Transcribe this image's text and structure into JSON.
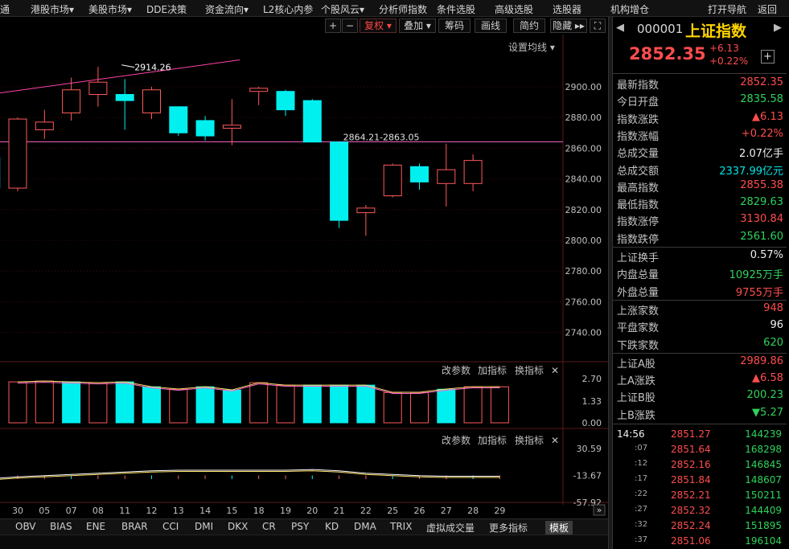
{
  "top_menu": [
    {
      "label": "通"
    },
    {
      "label": "港股市场▾"
    },
    {
      "label": "美股市场▾"
    },
    {
      "label": "DDE决策"
    },
    {
      "label": "资金流向▾"
    },
    {
      "label": "L2核心内参"
    },
    {
      "label": "个股风云▾"
    },
    {
      "label": "分析师指数"
    },
    {
      "label": "条件选股"
    },
    {
      "label": "高级选股"
    },
    {
      "label": "选股器"
    },
    {
      "label": "机构增仓"
    },
    {
      "label": "打开导航"
    },
    {
      "label": "返回"
    }
  ],
  "toolbar": {
    "plus": "+",
    "minus": "−",
    "fuquan": "复权 ▾",
    "overlay": "叠加 ▾",
    "chips": "筹码",
    "draw": "画线",
    "simple": "简约",
    "hide": "隐藏 ▸▸",
    "fullscreen": "⛶"
  },
  "ma_settings": "设置均线 ▾",
  "chart_data": [
    {
      "type": "candlestick",
      "x": [
        "29",
        "30",
        "05",
        "07",
        "08",
        "11",
        "12",
        "13",
        "14",
        "15",
        "18",
        "19",
        "20",
        "21",
        "22",
        "25",
        "26",
        "27",
        "28",
        "29"
      ],
      "x_tick_labels": [
        "30",
        "05",
        "07",
        "08",
        "11",
        "12",
        "13",
        "14",
        "15",
        "18",
        "19",
        "20",
        "21",
        "22",
        "25",
        "26",
        "27",
        "28",
        "29"
      ],
      "ohlc": [
        [
          2854,
          2868,
          2832,
          2834
        ],
        [
          2834,
          2880,
          2832,
          2879
        ],
        [
          2872,
          2885,
          2866,
          2877
        ],
        [
          2883,
          2906,
          2878,
          2898
        ],
        [
          2895,
          2913,
          2887,
          2903
        ],
        [
          2895,
          2905,
          2872,
          2891
        ],
        [
          2883,
          2900,
          2879,
          2898
        ],
        [
          2887,
          2887,
          2868,
          2870
        ],
        [
          2878,
          2881,
          2865,
          2868
        ],
        [
          2873,
          2892,
          2862,
          2875
        ],
        [
          2897,
          2900,
          2888,
          2899
        ],
        [
          2897,
          2898,
          2881,
          2885
        ],
        [
          2891,
          2892,
          2864,
          2864
        ],
        [
          2864,
          2864,
          2808,
          2813
        ],
        [
          2818,
          2823,
          2803,
          2821
        ],
        [
          2829,
          2850,
          2828,
          2849
        ],
        [
          2848,
          2850,
          2833,
          2838
        ],
        [
          2837,
          2863,
          2822,
          2846
        ],
        [
          2837,
          2856,
          2832,
          2852
        ]
      ],
      "y_ticks": [
        2900,
        2880,
        2860,
        2840,
        2820,
        2800,
        2780,
        2760,
        2740
      ],
      "y_tick_labels": [
        "2900.00",
        "2880.00",
        "2860.00",
        "2840.00",
        "2820.00",
        "2800.00",
        "2780.00",
        "2760.00",
        "2740.00"
      ],
      "ylim": [
        2722,
        2934
      ],
      "annotations": [
        {
          "text": "2914.26",
          "x": "11",
          "y": 2914.26
        },
        {
          "text": "2864.21-2863.05",
          "x": "21",
          "y": 2864.21
        }
      ],
      "hline": 2864.21
    },
    {
      "type": "bar",
      "name": "indicator-panel-1",
      "categories": [
        "30",
        "05",
        "07",
        "08",
        "11",
        "12",
        "13",
        "14",
        "15",
        "18",
        "19",
        "20",
        "21",
        "22",
        "25",
        "26",
        "27",
        "28",
        "29"
      ],
      "values": [
        2.5,
        2.55,
        2.5,
        2.45,
        2.5,
        2.2,
        2.05,
        2.2,
        2.0,
        2.45,
        2.3,
        2.3,
        2.3,
        2.3,
        1.85,
        1.85,
        2.05,
        2.2,
        2.2
      ],
      "colors_by_direction": [
        "up",
        "up",
        "down",
        "up",
        "down",
        "down",
        "up",
        "down",
        "down",
        "up",
        "up",
        "down",
        "down",
        "down",
        "up",
        "up",
        "down",
        "up",
        "up"
      ],
      "y_tick_labels": [
        "2.70",
        "1.33",
        "0.00"
      ],
      "ylim": [
        0,
        2.7
      ],
      "header_buttons": [
        "改参数",
        "加指标",
        "换指标",
        "✕"
      ]
    },
    {
      "type": "line",
      "name": "indicator-panel-2",
      "y_tick_labels": [
        "30.59",
        "-13.67",
        "-57.92"
      ],
      "ylim": [
        -57.92,
        30.59
      ],
      "header_buttons": [
        "改参数",
        "加指标",
        "换指标",
        "✕"
      ]
    }
  ],
  "bottom_tabs": [
    {
      "label": "OBV"
    },
    {
      "label": "BIAS"
    },
    {
      "label": "ENE"
    },
    {
      "label": "BRAR"
    },
    {
      "label": "CCI"
    },
    {
      "label": "DMI"
    },
    {
      "label": "DKX"
    },
    {
      "label": "CR"
    },
    {
      "label": "PSY"
    },
    {
      "label": "KD"
    },
    {
      "label": "DMA"
    },
    {
      "label": "TRIX"
    },
    {
      "label": "虚拟成交量"
    },
    {
      "label": "更多指标"
    },
    {
      "label": "模板"
    }
  ],
  "right_panel": {
    "code": "000001",
    "name": "上证指数",
    "price": "2852.35",
    "change": "+6.13",
    "change_pct": "+0.22%",
    "stats": [
      {
        "label": "最新指数",
        "value": "2852.35",
        "color": "red"
      },
      {
        "label": "今日开盘",
        "value": "2835.58",
        "color": "green"
      },
      {
        "label": "指数涨跌",
        "value": "▲6.13",
        "color": "red"
      },
      {
        "label": "指数涨幅",
        "value": "+0.22%",
        "color": "red"
      },
      {
        "label": "总成交量",
        "value": "2.07亿手",
        "color": "white"
      },
      {
        "label": "总成交额",
        "value": "2337.99亿元",
        "color": "cyan"
      },
      {
        "label": "最高指数",
        "value": "2855.38",
        "color": "red"
      },
      {
        "label": "最低指数",
        "value": "2829.63",
        "color": "green"
      },
      {
        "label": "指数涨停",
        "value": "3130.84",
        "color": "red"
      },
      {
        "label": "指数跌停",
        "value": "2561.60",
        "color": "green"
      }
    ],
    "stats2": [
      {
        "label": "上证换手",
        "value": "0.57%",
        "color": "white"
      },
      {
        "label": "内盘总量",
        "value": "10925万手",
        "color": "green"
      },
      {
        "label": "外盘总量",
        "value": "9755万手",
        "color": "red"
      }
    ],
    "stats3": [
      {
        "label": "上涨家数",
        "value": "948",
        "color": "red"
      },
      {
        "label": "平盘家数",
        "value": "96",
        "color": "white"
      },
      {
        "label": "下跌家数",
        "value": "620",
        "color": "green"
      }
    ],
    "stats4": [
      {
        "label": "上证A股",
        "value": "2989.86",
        "color": "red"
      },
      {
        "label": "上A涨跌",
        "value": "▲6.58",
        "color": "red"
      },
      {
        "label": "上证B股",
        "value": "200.23",
        "color": "green"
      },
      {
        "label": "上B涨跌",
        "value": "▼5.27",
        "color": "green"
      }
    ],
    "ticks": [
      {
        "time": "14:56",
        "price": "2851.27",
        "vol": "144239"
      },
      {
        "time": ":07",
        "price": "2851.64",
        "vol": "168298"
      },
      {
        "time": ":12",
        "price": "2852.16",
        "vol": "146845"
      },
      {
        "time": ":17",
        "price": "2851.84",
        "vol": "148607"
      },
      {
        "time": ":22",
        "price": "2852.21",
        "vol": "150211"
      },
      {
        "time": ":27",
        "price": "2852.32",
        "vol": "144409"
      },
      {
        "time": ":32",
        "price": "2852.24",
        "vol": "151895"
      },
      {
        "time": ":37",
        "price": "2851.06",
        "vol": "196104"
      }
    ]
  },
  "colors": {
    "up": "#ff5a5a",
    "down": "#00f0f0",
    "grid": "#3a0a0a",
    "trendline": "#ff44aa",
    "hline": "#ff66cc",
    "ma_yellow": "#ffe066",
    "ma_white": "#ffffff"
  }
}
